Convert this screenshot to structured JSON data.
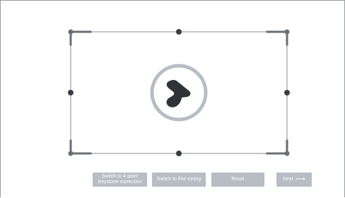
{
  "controls": {
    "btn_keystone_line1": "Switch to 4-point",
    "btn_keystone_line2": "Keystone correction",
    "btn_fine_tuning": "Switch to fine tuning",
    "btn_reset": "Reset",
    "btn_next": "Next",
    "next_arrow_icon": "arrow-right-icon"
  },
  "colors": {
    "frame_line": "#8a8d93",
    "handle": "#3a3d42",
    "corner_bracket": "#6a6e75",
    "logo_ring": "#b8bcc4",
    "logo_mark": "#2f3237",
    "button_bg": "#b8bcc4",
    "button_text": "#ffffff"
  }
}
